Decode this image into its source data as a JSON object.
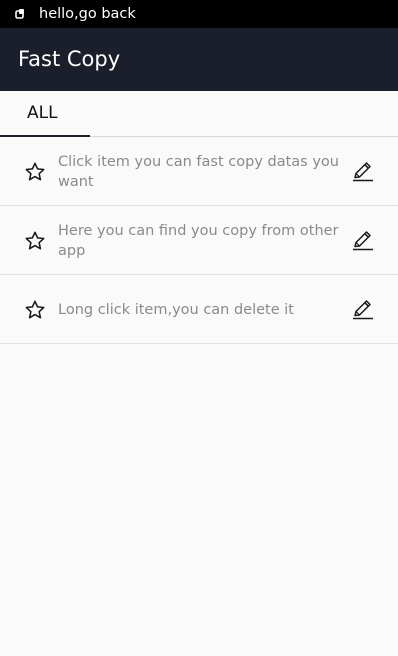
{
  "status_bar": {
    "notification_icon": "notification-icon",
    "text": "hello,go back"
  },
  "app_bar": {
    "title": "Fast Copy"
  },
  "tabs": [
    {
      "label": "ALL",
      "selected": true
    }
  ],
  "items": [
    {
      "text": "Click item you can fast copy datas you want",
      "star_icon": "star-outline-icon",
      "edit_icon": "pencil-icon"
    },
    {
      "text": "Here you can find you copy from other app",
      "star_icon": "star-outline-icon",
      "edit_icon": "pencil-icon"
    },
    {
      "text": "Long click item,you can delete it",
      "star_icon": "star-outline-icon",
      "edit_icon": "pencil-icon"
    }
  ],
  "colors": {
    "app_bar": "#1b1f2b",
    "status_bar": "#000000",
    "background": "#fafafa",
    "item_text": "#8a8a8a"
  }
}
